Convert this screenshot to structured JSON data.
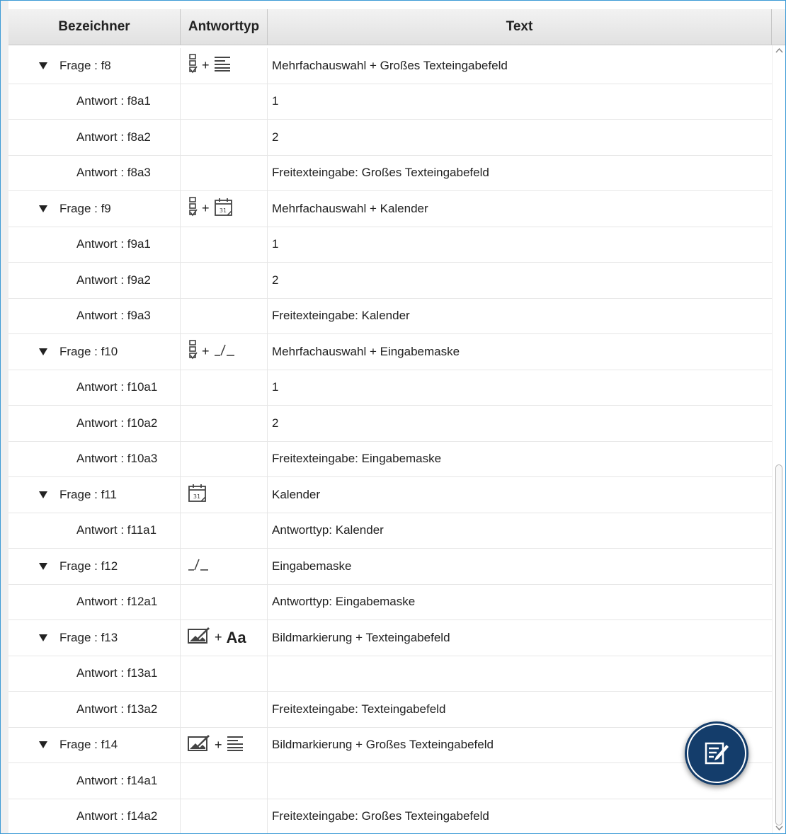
{
  "header": {
    "col_identifier": "Bezeichner",
    "col_answer_type": "Antworttyp",
    "col_text": "Text"
  },
  "rows": [
    {
      "kind": "question",
      "label": "Frage : f8",
      "icons": [
        "multiple-choice-icon",
        "large-text-field-icon"
      ],
      "text": "Mehrfachauswahl + Großes Texteingabefeld"
    },
    {
      "kind": "answer",
      "label": "Antwort : f8a1",
      "icons": [],
      "text": "1"
    },
    {
      "kind": "answer",
      "label": "Antwort : f8a2",
      "icons": [],
      "text": "2"
    },
    {
      "kind": "answer",
      "label": "Antwort : f8a3",
      "icons": [],
      "text": "Freitexteingabe: Großes Texteingabefeld"
    },
    {
      "kind": "question",
      "label": "Frage : f9",
      "icons": [
        "multiple-choice-icon",
        "calendar-icon"
      ],
      "text": "Mehrfachauswahl + Kalender"
    },
    {
      "kind": "answer",
      "label": "Antwort : f9a1",
      "icons": [],
      "text": "1"
    },
    {
      "kind": "answer",
      "label": "Antwort : f9a2",
      "icons": [],
      "text": "2"
    },
    {
      "kind": "answer",
      "label": "Antwort : f9a3",
      "icons": [],
      "text": "Freitexteingabe: Kalender"
    },
    {
      "kind": "question",
      "label": "Frage : f10",
      "icons": [
        "multiple-choice-icon",
        "input-mask-icon"
      ],
      "text": "Mehrfachauswahl + Eingabemaske"
    },
    {
      "kind": "answer",
      "label": "Antwort : f10a1",
      "icons": [],
      "text": "1"
    },
    {
      "kind": "answer",
      "label": "Antwort : f10a2",
      "icons": [],
      "text": "2"
    },
    {
      "kind": "answer",
      "label": "Antwort : f10a3",
      "icons": [],
      "text": "Freitexteingabe: Eingabemaske"
    },
    {
      "kind": "question",
      "label": "Frage : f11",
      "icons": [
        "calendar-icon"
      ],
      "text": "Kalender"
    },
    {
      "kind": "answer",
      "label": "Antwort : f11a1",
      "icons": [],
      "text": "Antworttyp: Kalender"
    },
    {
      "kind": "question",
      "label": "Frage : f12",
      "icons": [
        "input-mask-icon"
      ],
      "text": "Eingabemaske"
    },
    {
      "kind": "answer",
      "label": "Antwort : f12a1",
      "icons": [],
      "text": "Antworttyp: Eingabemaske"
    },
    {
      "kind": "question",
      "label": "Frage : f13",
      "icons": [
        "image-marking-icon",
        "text-field-icon"
      ],
      "text": "Bildmarkierung + Texteingabefeld"
    },
    {
      "kind": "answer",
      "label": "Antwort : f13a1",
      "icons": [],
      "text": ""
    },
    {
      "kind": "answer",
      "label": "Antwort : f13a2",
      "icons": [],
      "text": "Freitexteingabe: Texteingabefeld"
    },
    {
      "kind": "question",
      "label": "Frage : f14",
      "icons": [
        "image-marking-icon",
        "large-text-field-icon"
      ],
      "text": "Bildmarkierung + Großes Texteingabefeld"
    },
    {
      "kind": "answer",
      "label": "Antwort : f14a1",
      "icons": [],
      "text": ""
    },
    {
      "kind": "answer",
      "label": "Antwort : f14a2",
      "icons": [],
      "text": "Freitexteingabe: Großes Texteingabefeld"
    }
  ],
  "icon_text": {
    "text_field_glyph": "Aa",
    "plus": "+"
  },
  "fab": {
    "icon": "edit-note-icon"
  },
  "colors": {
    "accent_border": "#3c9ad6",
    "fab_background": "#143d6b"
  }
}
